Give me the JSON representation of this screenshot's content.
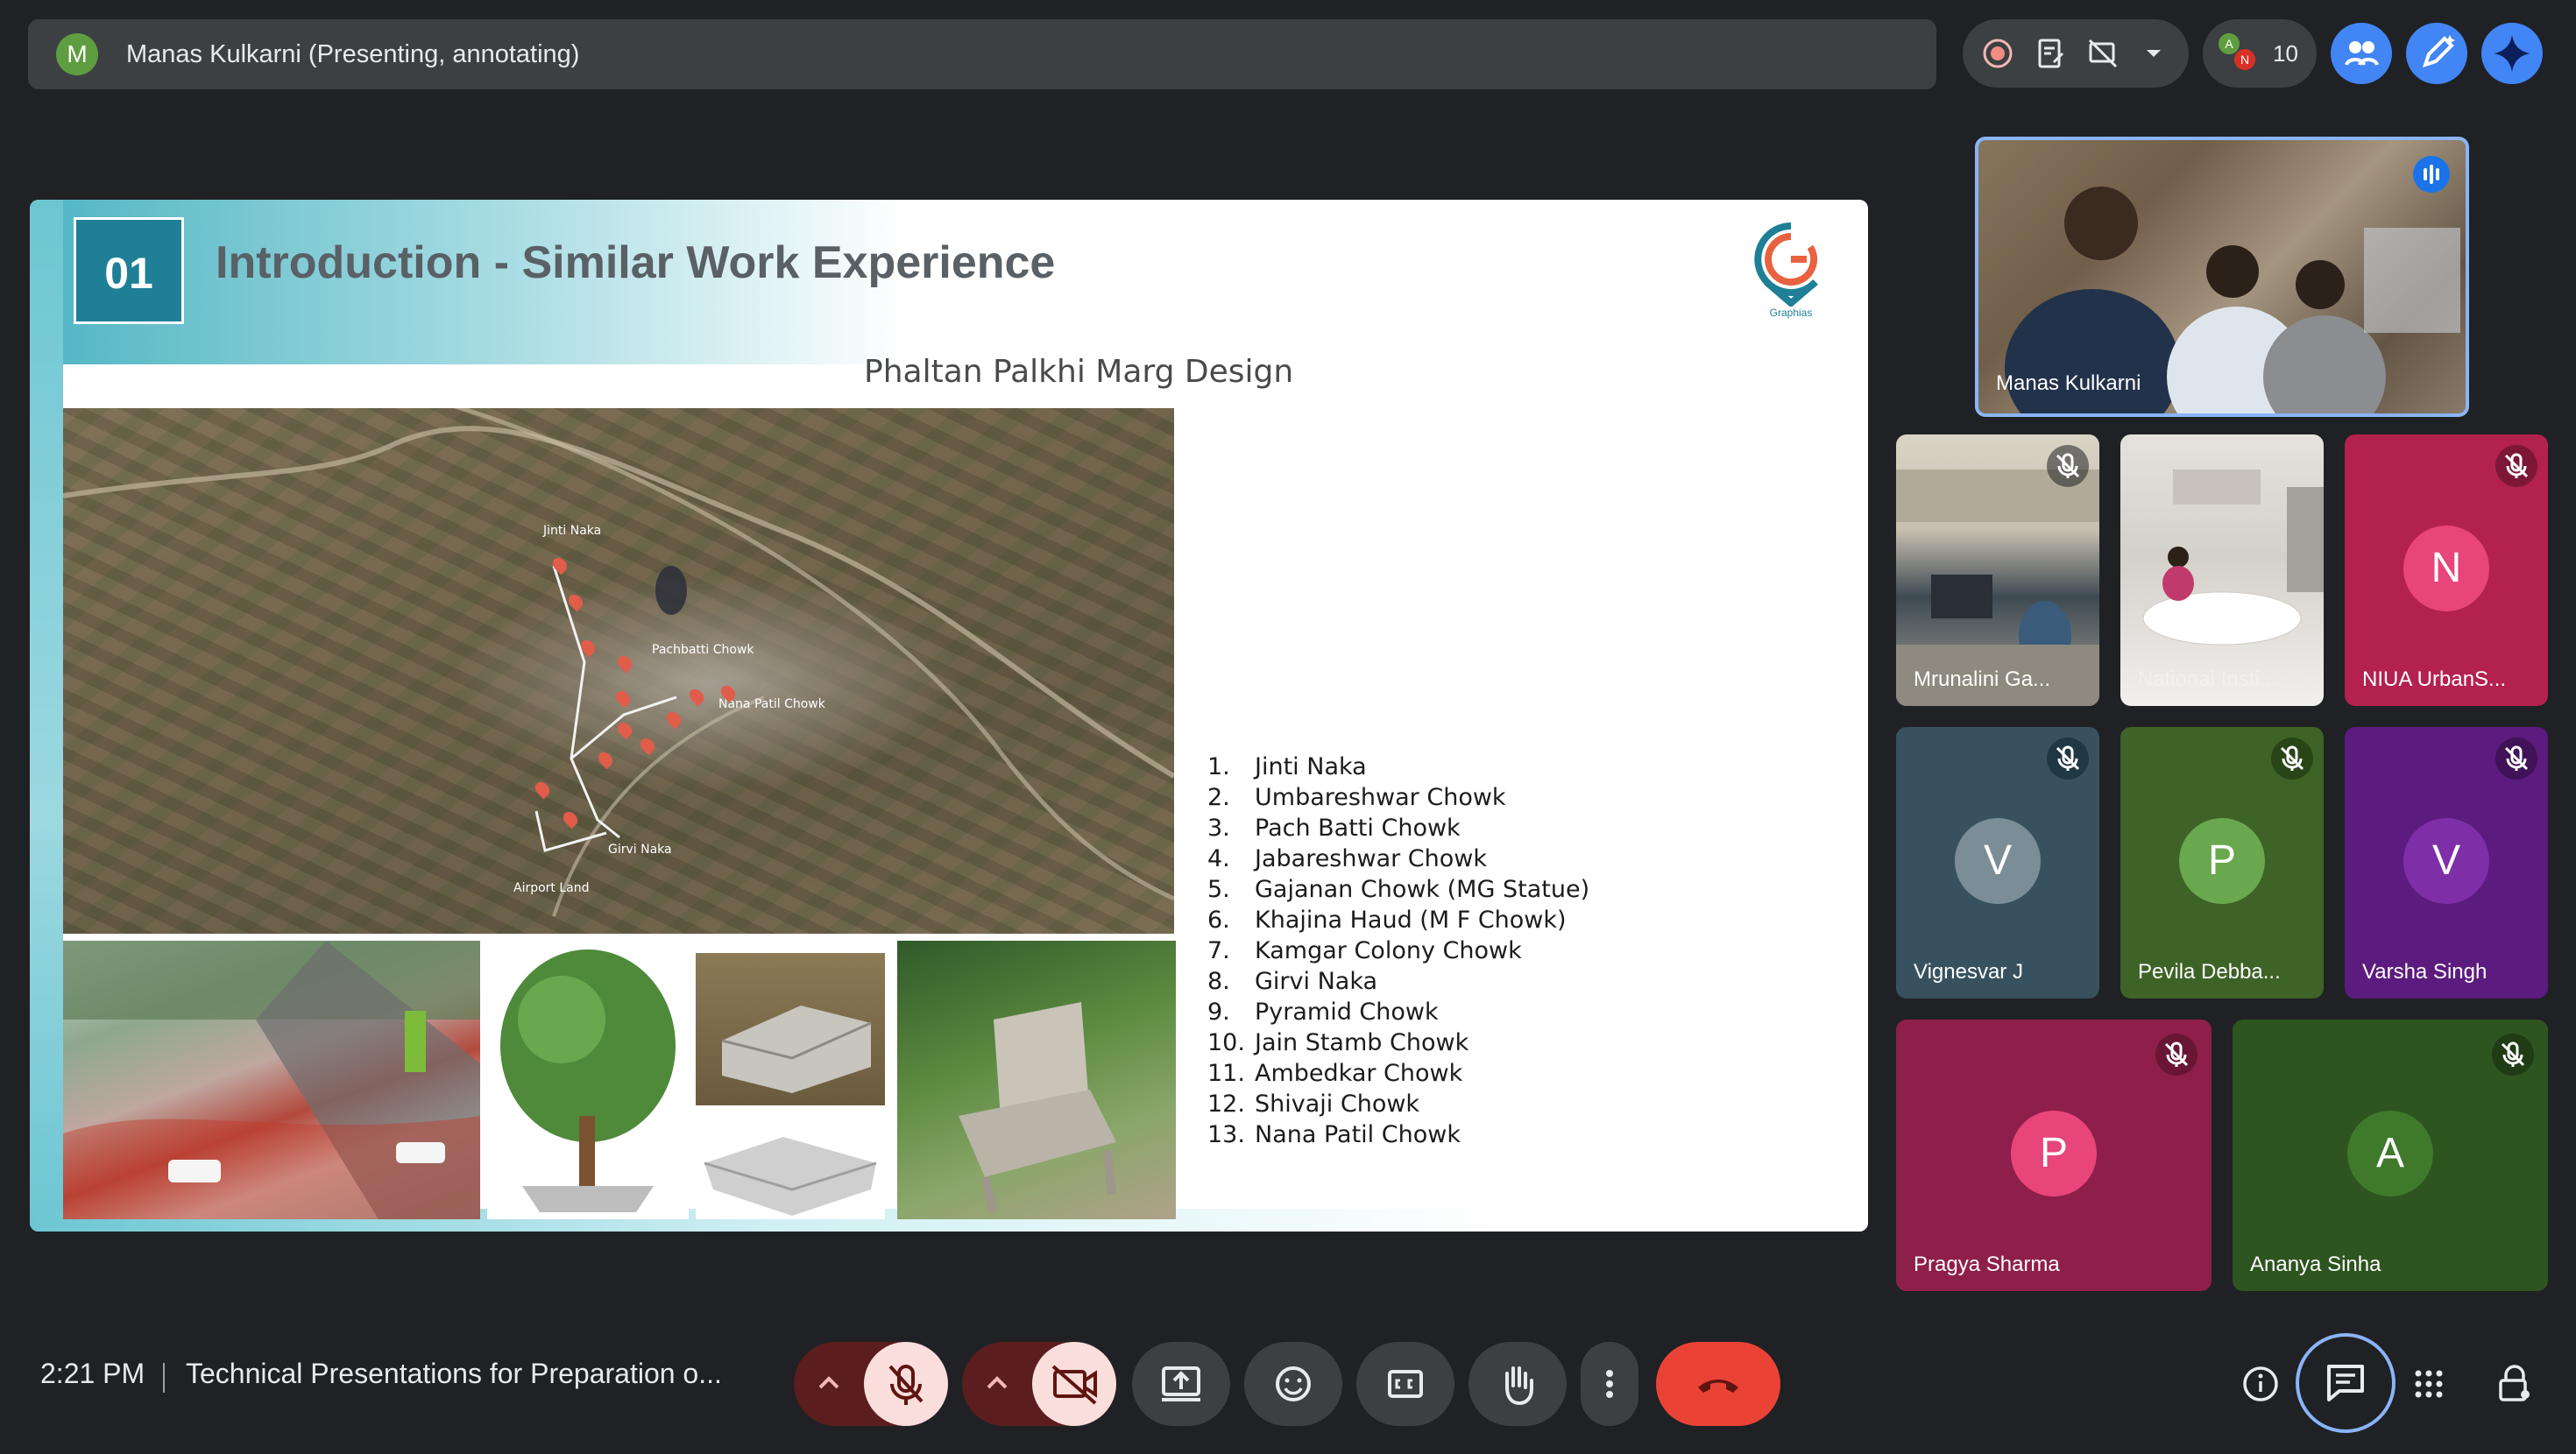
{
  "presenting": {
    "avatar_letter": "M",
    "text": "Manas Kulkarni (Presenting, annotating)"
  },
  "top_controls": {
    "participant_count": "10",
    "mini_avatars": [
      "A",
      "N"
    ]
  },
  "slide": {
    "number": "01",
    "title": "Introduction - Similar Work Experience",
    "logo_text": "Graphias",
    "subtitle": "Phaltan Palkhi Marg Design",
    "map_labels": [
      "Jinti Naka",
      "Pachbatti Chowk",
      "Nana Patil Chowk",
      "Girvi Naka",
      "Airport Land"
    ],
    "locations": [
      {
        "num": "1.",
        "name": "Jinti Naka"
      },
      {
        "num": "2.",
        "name": "Umbareshwar Chowk"
      },
      {
        "num": "3.",
        "name": "Pach Batti Chowk"
      },
      {
        "num": "4.",
        "name": "Jabareshwar Chowk"
      },
      {
        "num": "5.",
        "name": "Gajanan Chowk (MG Statue)"
      },
      {
        "num": "6.",
        "name": "Khajina Haud (M F Chowk)"
      },
      {
        "num": "7.",
        "name": "Kamgar Colony Chowk"
      },
      {
        "num": "8.",
        "name": "Girvi Naka"
      },
      {
        "num": "9.",
        "name": "Pyramid Chowk"
      },
      {
        "num": "10.",
        "name": "Jain Stamb Chowk"
      },
      {
        "num": "11.",
        "name": "Ambedkar Chowk"
      },
      {
        "num": "12.",
        "name": "Shivaji Chowk"
      },
      {
        "num": "13.",
        "name": "Nana Patil Chowk"
      }
    ]
  },
  "participants": {
    "presenter": {
      "name": "Manas Kulkarni"
    },
    "tiles": [
      {
        "name": "Mrunalini Ga...",
        "muted": true
      },
      {
        "name": "National Insti...",
        "muted": false
      },
      {
        "name": "NIUA UrbanS...",
        "letter": "N",
        "muted": true
      },
      {
        "name": "Vignesvar J",
        "letter": "V",
        "muted": true
      },
      {
        "name": "Pevila Debba...",
        "letter": "P",
        "muted": true
      },
      {
        "name": "Varsha Singh",
        "letter": "V",
        "muted": true
      },
      {
        "name": "Pragya Sharma",
        "letter": "P",
        "muted": true
      },
      {
        "name": "Ananya Sinha",
        "letter": "A",
        "muted": true
      }
    ]
  },
  "bottom": {
    "time": "2:21 PM",
    "meeting_title": "Technical Presentations for Preparation o..."
  },
  "colors": {
    "background": "#202124",
    "end_call": "#ea4335",
    "muted_warning": "#5b1d1d",
    "accent_blue": "#4285f4"
  }
}
